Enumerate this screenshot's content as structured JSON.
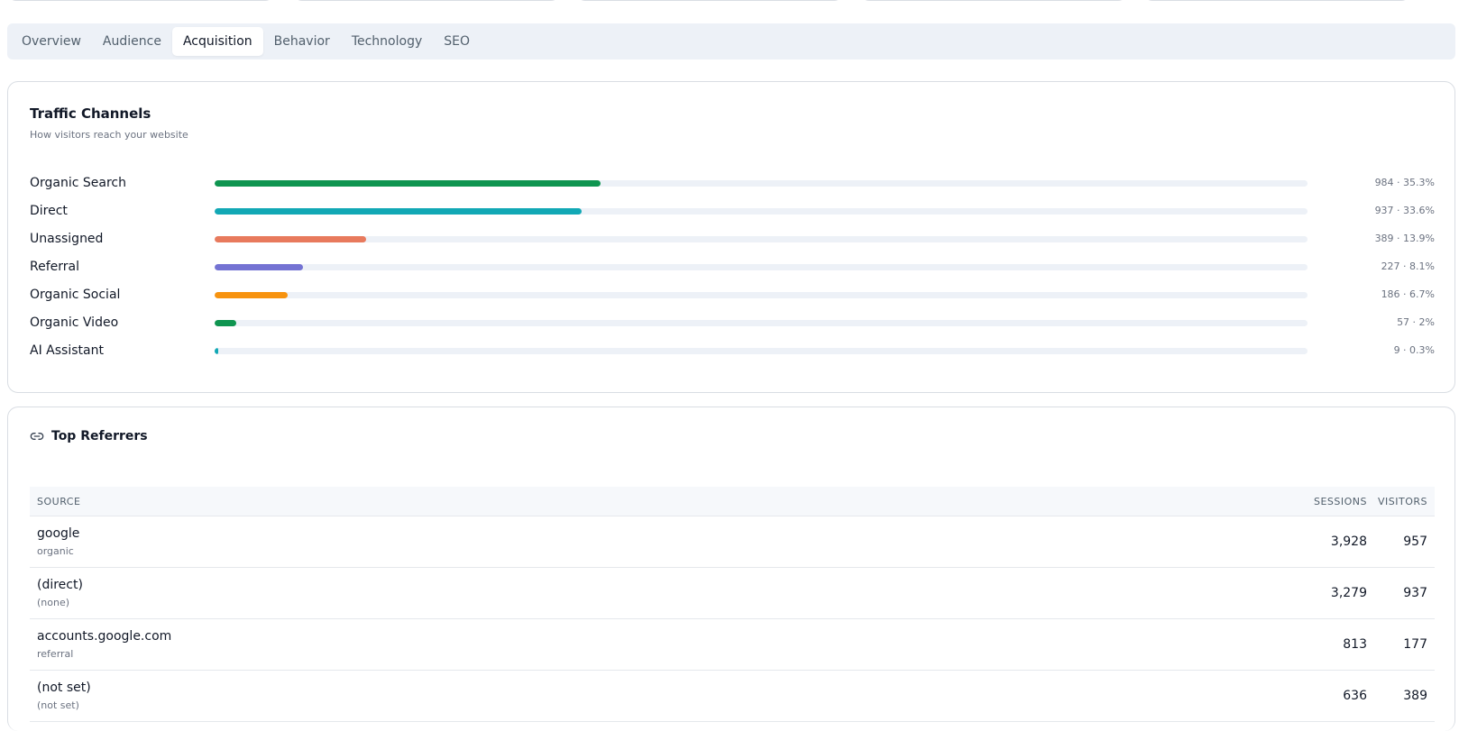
{
  "tabs": [
    {
      "label": "Overview"
    },
    {
      "label": "Audience"
    },
    {
      "label": "Acquisition",
      "active": true
    },
    {
      "label": "Behavior"
    },
    {
      "label": "Technology"
    },
    {
      "label": "SEO"
    }
  ],
  "traffic_channels": {
    "title": "Traffic Channels",
    "subtitle": "How visitors reach your website",
    "channels": [
      {
        "label": "Organic Search",
        "value_text": "984 · 35.3%",
        "share": 35.3,
        "color": "#0f9550"
      },
      {
        "label": "Direct",
        "value_text": "937 · 33.6%",
        "share": 33.6,
        "color": "#12a8b5"
      },
      {
        "label": "Unassigned",
        "value_text": "389 · 13.9%",
        "share": 13.9,
        "color": "#e87a5d"
      },
      {
        "label": "Referral",
        "value_text": "227 · 8.1%",
        "share": 8.1,
        "color": "#7473d3"
      },
      {
        "label": "Organic Social",
        "value_text": "186 · 6.7%",
        "share": 6.7,
        "color": "#f7930f"
      },
      {
        "label": "Organic Video",
        "value_text": "57 · 2%",
        "share": 2,
        "color": "#0f9550"
      },
      {
        "label": "AI Assistant",
        "value_text": "9 · 0.3%",
        "share": 0.3,
        "color": "#12a8b5"
      }
    ]
  },
  "top_referrers": {
    "title": "Top Referrers",
    "icon": "link-icon",
    "columns": {
      "source": "SOURCE",
      "sessions": "SESSIONS",
      "visitors": "VISITORS"
    },
    "rows": [
      {
        "name": "google",
        "medium": "organic",
        "sessions": "3,928",
        "visitors": "957"
      },
      {
        "name": "(direct)",
        "medium": "(none)",
        "sessions": "3,279",
        "visitors": "937"
      },
      {
        "name": "accounts.google.com",
        "medium": "referral",
        "sessions": "813",
        "visitors": "177"
      },
      {
        "name": "(not set)",
        "medium": "(not set)",
        "sessions": "636",
        "visitors": "389"
      }
    ]
  }
}
